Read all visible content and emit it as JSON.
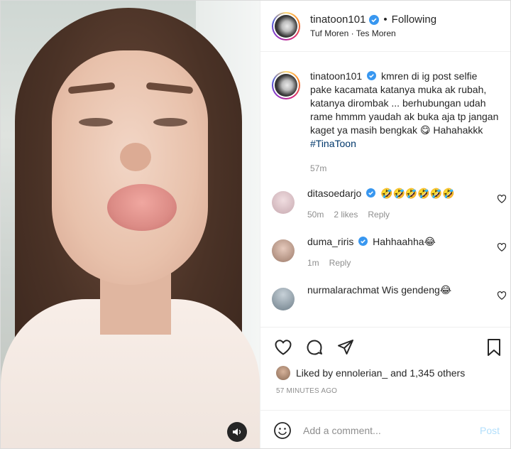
{
  "post": {
    "username": "tinatoon101",
    "verified": true,
    "follow_status": "Following",
    "separator": "•",
    "location": "Tuf Moren · Tes Moren"
  },
  "caption": {
    "username": "tinatoon101",
    "text": "kmren di ig post selfie pake kacamata katanya muka ak rubah, katanya dirombak ... berhubungan udah rame hmmm yaudah ak buka aja tp jangan kaget ya masih bengkak 😋 Hahahakkk",
    "hashtag": "#TinaToon",
    "age": "57m"
  },
  "comments": [
    {
      "username": "ditasoedarjo",
      "verified": true,
      "text": "🤣🤣🤣🤣🤣🤣",
      "age": "50m",
      "likes": "2 likes",
      "reply": "Reply",
      "avatar_color": "#d9c3c8"
    },
    {
      "username": "duma_riris",
      "verified": true,
      "text": "Hahhaahha😂",
      "age": "1m",
      "likes": "",
      "reply": "Reply",
      "avatar_color": "#c9a999"
    },
    {
      "username": "nurmalarachmat",
      "verified": false,
      "text": "Wis gendeng😂",
      "age": "",
      "likes": "",
      "reply": "",
      "avatar_color": "#8a9aa6"
    }
  ],
  "actions": {
    "icons": [
      "heart-icon",
      "comment-icon",
      "share-icon",
      "bookmark-icon"
    ]
  },
  "likes": {
    "prefix": "Liked by",
    "user": "ennolerian_",
    "rest": "and 1,345 others"
  },
  "timestamp": "57 MINUTES AGO",
  "add_comment": {
    "placeholder": "Add a comment...",
    "post_label": "Post"
  },
  "colors": {
    "verified": "#3897f0",
    "link": "#00376b",
    "muted": "#8e8e8e",
    "post_disabled": "#b2dffc"
  }
}
